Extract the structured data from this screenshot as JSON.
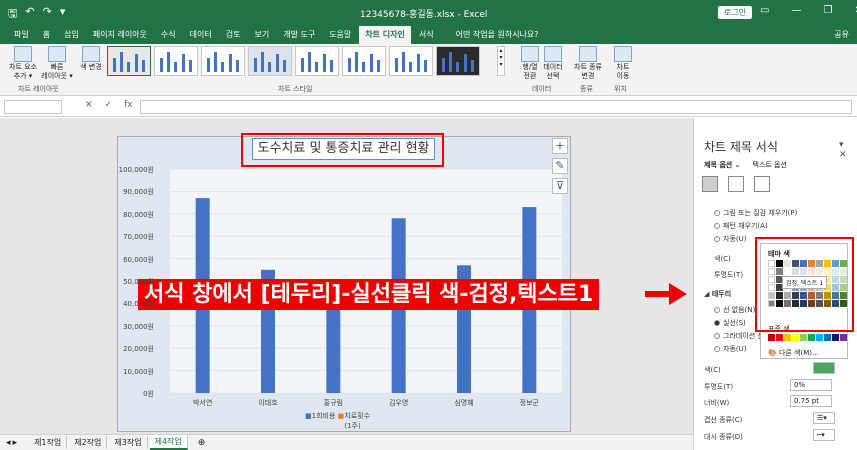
{
  "titlebar": {
    "qat": [
      "🖫",
      "↶",
      "↷",
      "▾"
    ],
    "title": "12345678-홍길동.xlsx - Excel",
    "login": "로그인",
    "controls": [
      "▭",
      "—",
      "❐",
      "✕"
    ],
    "bg_color": "#217346"
  },
  "tabs": [
    "파일",
    "홈",
    "삽입",
    "페이지 레이아웃",
    "수식",
    "데이터",
    "검토",
    "보기",
    "개발 도구",
    "도움말",
    "차트 디자인",
    "서식"
  ],
  "active_tab": "차트 디자인",
  "tellme": "어떤 작업을 원하시나요?",
  "share": "공유",
  "ribbon": {
    "add_element": "차트 요소\n추가 ▾",
    "quick_layout": "빠른\n레이아웃 ▾",
    "change_color": "색 변경",
    "group_layout": "차트 레이아웃",
    "group_styles": "차트 스타일",
    "switch_row_col": "행/열\n전환",
    "select_data": "데이터\n선택",
    "group_data": "데이터",
    "change_type": "차트 종류\n변경",
    "group_type": "종류",
    "move_chart": "차트\n이동",
    "group_location": "위치"
  },
  "formula": {
    "cancel": "✕",
    "enter": "✓",
    "fx": "fx"
  },
  "chart_data": {
    "type": "bar",
    "title": "도수치료 및 통증치료 관리 현황",
    "categories": [
      "박서연",
      "이태호",
      "홍규림",
      "김우영",
      "심명혜",
      "정보군"
    ],
    "series": [
      {
        "name": "1회비용",
        "values": [
          87000,
          55000,
          49000,
          78000,
          57000,
          83000
        ]
      },
      {
        "name": "치료횟수",
        "values": [
          0,
          0,
          0,
          0,
          0,
          0
        ]
      }
    ],
    "legend_sub": "(1주)",
    "ylim": [
      0,
      100000
    ],
    "yticks": [
      "0원",
      "10,000원",
      "20,000원",
      "30,000원",
      "40,000원",
      "50,000원",
      "60,000원",
      "70,000원",
      "80,000원",
      "90,000원",
      "100,000원"
    ],
    "grid": true,
    "bar_color": "#4472c4"
  },
  "caption": "서식 창에서 [테두리]-실선클릭 색-검정,텍스트1",
  "pane": {
    "title": "차트 제목 서식",
    "tab_options": "제목 옵션 ⌄",
    "tab_text": "텍스트 옵션",
    "fill_picture": "그림 또는 질감 채우기(P)",
    "fill_pattern": "패턴 채우기(A)",
    "fill_auto": "자동(U)",
    "color_label": "색(C)",
    "transparency": "투명도(T)",
    "border_header": "테두리",
    "line_none": "선 없음(N)",
    "line_solid": "실선(S)",
    "line_gradient": "그라데이션 선(G)",
    "line_auto": "자동(U)",
    "color_label2": "색(C)",
    "transparency2": "투명도(T)",
    "transparency_value": "0%",
    "width_label": "너비(W)",
    "width_value": "0.75 pt",
    "compound": "겹선 종류(C)",
    "dash": "대시 종류(D)"
  },
  "popup": {
    "theme_colors": "테마 색",
    "tooltip": "검정, 텍스트 1",
    "standard_colors": "표준 색",
    "more_colors": "다른 색(M)..."
  },
  "sheets": [
    "제1작업",
    "제2작업",
    "제3작업",
    "제4작업"
  ],
  "active_sheet": "제4작업"
}
